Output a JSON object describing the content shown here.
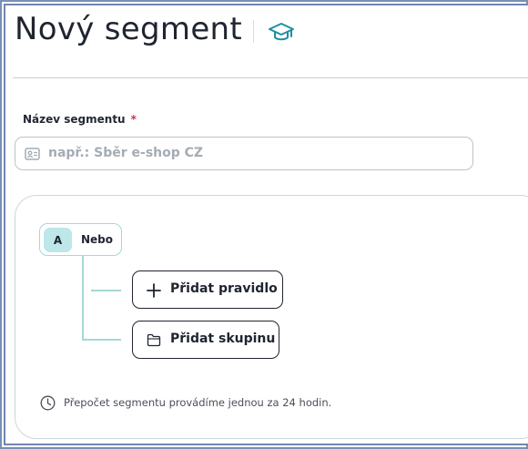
{
  "page": {
    "title": "Nový segment"
  },
  "form": {
    "name_label": "Název segmentu",
    "required_mark": "*",
    "name_input": {
      "value": "",
      "placeholder": "např.: Sběr e-shop CZ"
    }
  },
  "builder": {
    "group": {
      "badge": "A",
      "operator": "Nebo"
    },
    "actions": {
      "add_rule": "Přidat pravidlo",
      "add_group": "Přidat skupinu"
    },
    "note": "Přepočet segmentu provádíme jednou za 24 hodin."
  },
  "icons": {
    "header": "graduation-cap-icon",
    "input": "id-card-icon",
    "add_rule": "plus-icon",
    "add_group": "folder-icon",
    "note": "clock-icon"
  },
  "colors": {
    "accent": "#1e8fa3",
    "tree_line": "#a6d7d8",
    "badge_bg": "#bde7e8",
    "required": "#d6304a",
    "text": "#1f2430"
  }
}
